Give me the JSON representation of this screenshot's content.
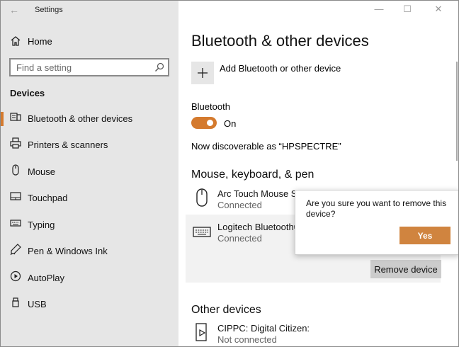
{
  "window": {
    "title": "Settings",
    "back_glyph": "←",
    "minimize_glyph": "—",
    "maximize_glyph": "☐",
    "close_glyph": "✕"
  },
  "sidebar": {
    "home_label": "Home",
    "search_placeholder": "Find a setting",
    "section_title": "Devices",
    "items": [
      {
        "label": "Bluetooth & other devices",
        "icon": "bluetooth-devices-icon",
        "active": true
      },
      {
        "label": "Printers & scanners",
        "icon": "printer-icon",
        "active": false
      },
      {
        "label": "Mouse",
        "icon": "mouse-icon",
        "active": false
      },
      {
        "label": "Touchpad",
        "icon": "touchpad-icon",
        "active": false
      },
      {
        "label": "Typing",
        "icon": "keyboard-icon",
        "active": false
      },
      {
        "label": "Pen & Windows Ink",
        "icon": "pen-icon",
        "active": false
      },
      {
        "label": "AutoPlay",
        "icon": "autoplay-icon",
        "active": false
      },
      {
        "label": "USB",
        "icon": "usb-icon",
        "active": false
      }
    ]
  },
  "main": {
    "title": "Bluetooth & other devices",
    "add_label": "Add Bluetooth or other device",
    "bluetooth_label": "Bluetooth",
    "toggle_state": "On",
    "discoverable": "Now discoverable as “HPSPECTRE”",
    "section_mouse": "Mouse, keyboard, & pen",
    "devices": [
      {
        "name": "Arc Touch Mouse Sur",
        "status": "Connected",
        "icon": "mouse-icon"
      },
      {
        "name": "Logitech Bluetooth®",
        "status": "Connected",
        "icon": "keyboard-icon"
      }
    ],
    "remove_label": "Remove device",
    "section_other": "Other devices",
    "other_devices": [
      {
        "name": "CIPPC: Digital Citizen:",
        "status": "Not connected",
        "icon": "media-device-icon"
      }
    ]
  },
  "popup": {
    "question": "Are you sure you want to remove this device?",
    "yes_label": "Yes"
  },
  "colors": {
    "accent": "#d47a2e",
    "sidebar_bg": "#e6e6e6",
    "button_gray": "#cccccc"
  }
}
